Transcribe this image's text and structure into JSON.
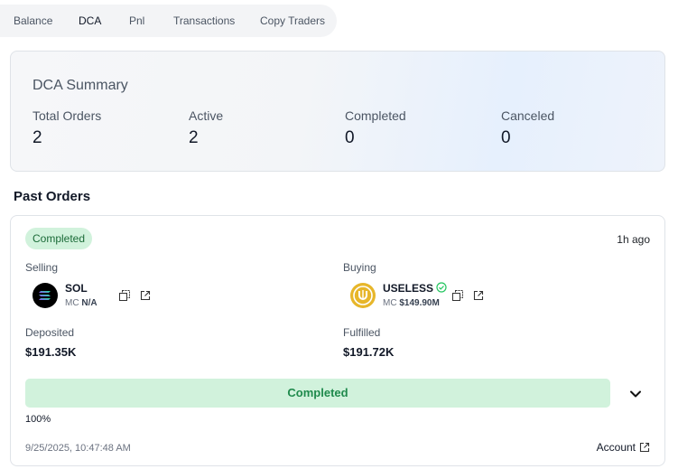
{
  "tabs": [
    {
      "label": "Balance"
    },
    {
      "label": "DCA"
    },
    {
      "label": "Pnl"
    },
    {
      "label": "Transactions"
    },
    {
      "label": "Copy Traders"
    }
  ],
  "active_tab": "DCA",
  "summary": {
    "title": "DCA Summary",
    "stats": [
      {
        "label": "Total Orders",
        "value": "2"
      },
      {
        "label": "Active",
        "value": "2"
      },
      {
        "label": "Completed",
        "value": "0"
      },
      {
        "label": "Canceled",
        "value": "0"
      }
    ]
  },
  "past_orders": {
    "title": "Past Orders",
    "order": {
      "status": "Completed",
      "time_ago": "1h ago",
      "selling": {
        "label": "Selling",
        "token": "SOL",
        "mc_label": "MC",
        "mc_value": "N/A",
        "icon": "solana-icon"
      },
      "buying": {
        "label": "Buying",
        "token": "USELESS",
        "mc_label": "MC",
        "mc_value": "$149.90M",
        "icon": "useless-token-icon",
        "verified": true
      },
      "deposited": {
        "label": "Deposited",
        "value": "$191.35K"
      },
      "fulfilled": {
        "label": "Fulfilled",
        "value": "$191.72K"
      },
      "progress": {
        "label": "Completed",
        "percent_text": "100%",
        "fraction": 1.0
      },
      "date": "9/25/2025, 10:47:48 AM",
      "account_link": "Account"
    }
  },
  "colors": {
    "badge_bg": "#d1f2dc",
    "badge_text": "#1b6b38",
    "progress_text": "#1f8a4c",
    "useless_gold": "#e7b62a"
  }
}
